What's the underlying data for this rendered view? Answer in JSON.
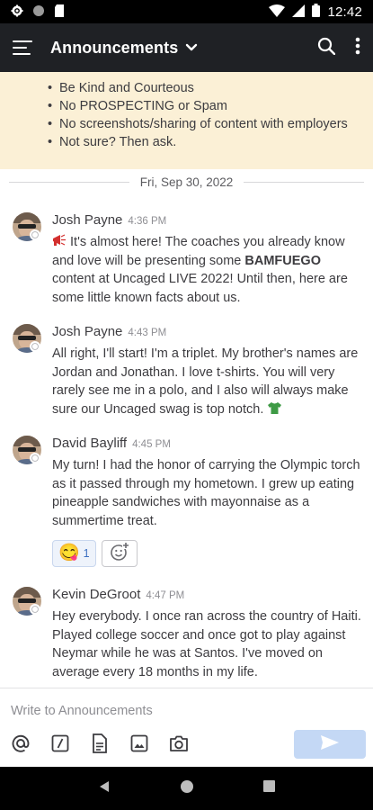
{
  "status_bar": {
    "time": "12:42"
  },
  "header": {
    "channel_name": "Announcements"
  },
  "banner": {
    "rules": [
      "Be Kind and Courteous",
      "No PROSPECTING or Spam",
      "No screenshots/sharing of content with employers",
      "Not sure? Then ask."
    ]
  },
  "date_separator": "Fri, Sep 30, 2022",
  "posts": [
    {
      "author": "Josh Payne",
      "time": "4:36 PM",
      "text_before": "It's almost here! The coaches you already know and love will be presenting some ",
      "text_bold": "BAMFUEGO",
      "text_after": " content at Uncaged LIVE 2022! Until then, here are some little known facts about us."
    },
    {
      "author": "Josh Payne",
      "time": "4:43 PM",
      "text": "All right, I'll start! I'm a triplet. My brother's names are Jordan and Jonathan. I love t-shirts. You will very rarely see me in a polo, and I also will always make sure our Uncaged swag is top notch."
    },
    {
      "author": "David Bayliff",
      "time": "4:45 PM",
      "text": "My turn! I had the honor of carrying the Olympic torch as it passed through my hometown. I grew up eating pineapple sandwiches with mayonnaise as a summertime treat.",
      "reaction": {
        "emoji": "😋",
        "count": "1"
      }
    },
    {
      "author": "Kevin DeGroot",
      "time": "4:47 PM",
      "text": "Hey everybody. I once ran across the country of Haiti. Played college soccer and once got to play against Neymar while he was at Santos. I've moved on average every 18 months in my life."
    }
  ],
  "composer": {
    "placeholder": "Write to Announcements"
  },
  "icons": {
    "status": [
      "settings-icon",
      "circle-icon",
      "sd-card-icon",
      "wifi-icon",
      "signal-icon",
      "battery-icon"
    ],
    "header": [
      "hamburger-icon",
      "chevron-down-icon",
      "search-icon",
      "more-vert-icon"
    ],
    "toolbar": [
      "at-mention-icon",
      "slash-command-icon",
      "file-icon",
      "image-icon",
      "camera-icon",
      "send-icon"
    ],
    "nav": [
      "back-icon",
      "home-icon",
      "recents-icon"
    ]
  },
  "colors": {
    "header_bg": "#1f2125",
    "banner_bg": "#fbf0d6",
    "send_bg": "#c4d8f5",
    "reaction_count": "#3b6fc1"
  }
}
